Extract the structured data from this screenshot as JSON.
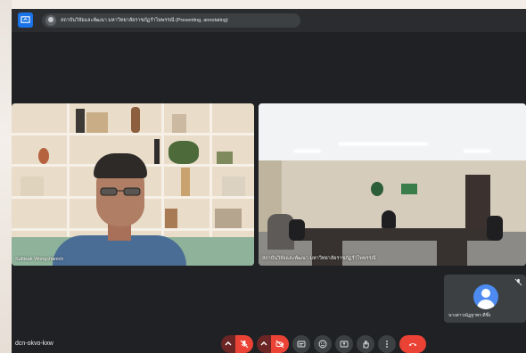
{
  "presenter": {
    "label": "สถาบันวิจัยและพัฒนา มหาวิทยาลัยราชภัฏรำไพพรรณี (Presenting, annotating)"
  },
  "tiles": [
    {
      "name": "Suttisak Wongchanich"
    },
    {
      "name": "สถาบันวิจัยและพัฒนา มหาวิทยาลัยราชภัฏรำไพพรรณี"
    }
  ],
  "self_tile": {
    "name": "นางสาวณัฏฐาพร ดีซึ่ง"
  },
  "meeting": {
    "code": "dcn-okvo-kxw"
  },
  "controls": [
    {
      "name": "mic-options",
      "icon": "chevron-up-icon"
    },
    {
      "name": "mic-toggle",
      "icon": "mic-off-icon",
      "state": "off"
    },
    {
      "name": "camera-options",
      "icon": "chevron-up-icon"
    },
    {
      "name": "camera-toggle",
      "icon": "camera-off-icon",
      "state": "off"
    },
    {
      "name": "captions",
      "icon": "captions-icon"
    },
    {
      "name": "emoji",
      "icon": "emoji-icon"
    },
    {
      "name": "present",
      "icon": "present-screen-icon"
    },
    {
      "name": "raise-hand",
      "icon": "hand-icon"
    },
    {
      "name": "more-options",
      "icon": "more-vert-icon"
    },
    {
      "name": "leave-call",
      "icon": "call-end-icon"
    }
  ],
  "colors": {
    "background": "#202124",
    "accent_blue": "#1a73e8",
    "danger_red": "#ea4335"
  }
}
